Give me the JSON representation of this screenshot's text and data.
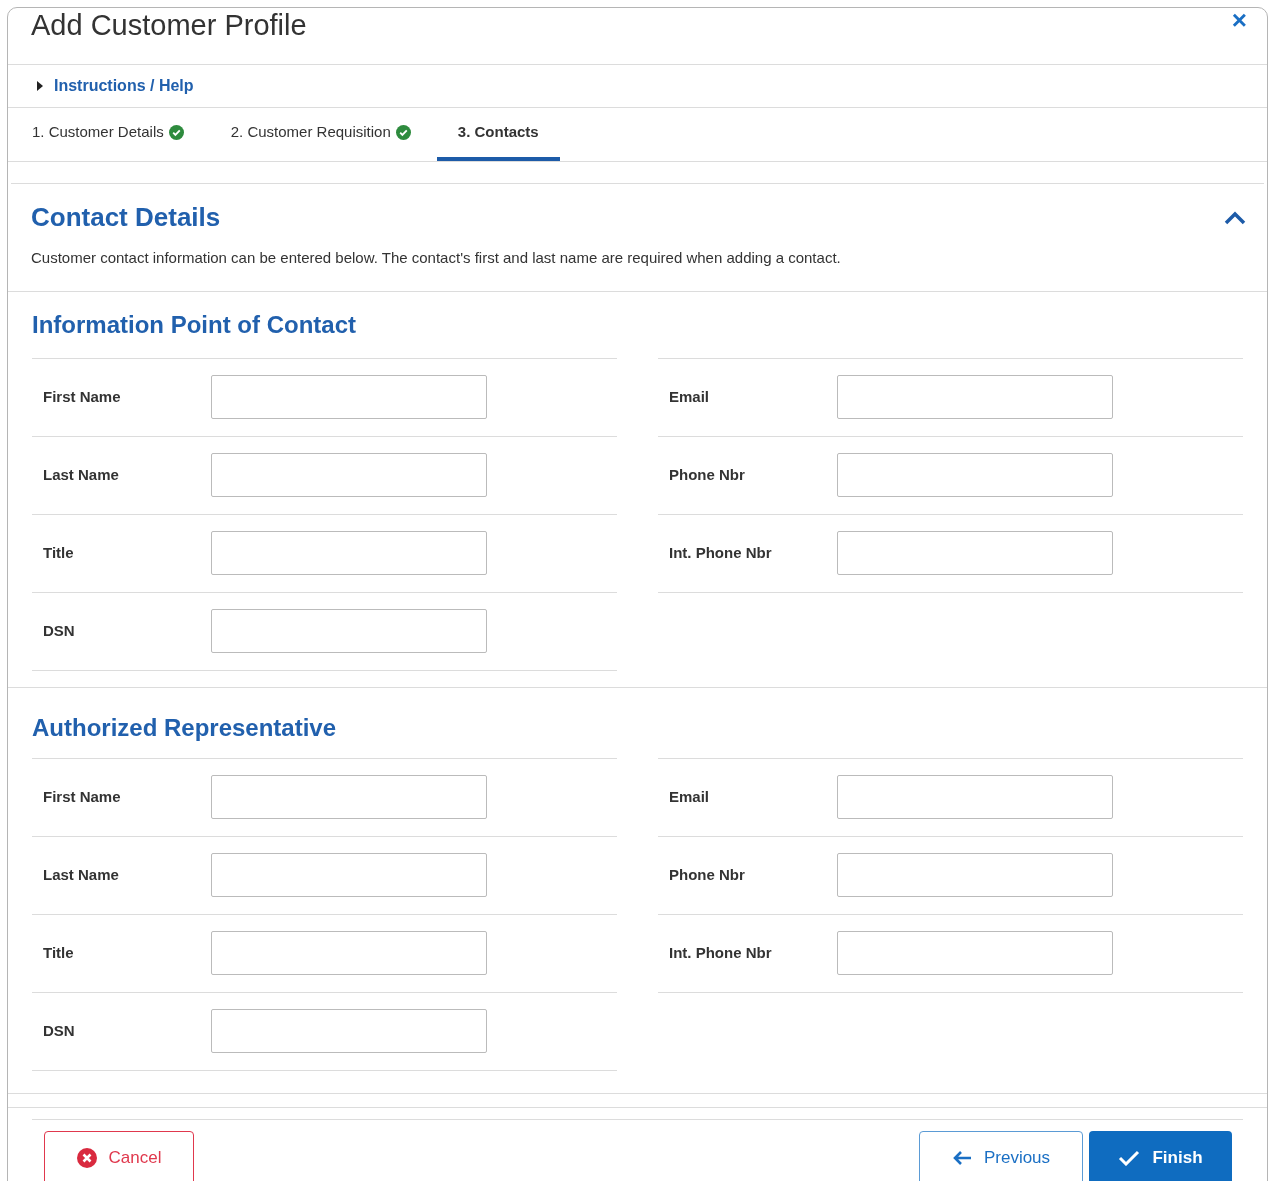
{
  "window": {
    "title": "Add Customer Profile",
    "close": "×"
  },
  "instructions": {
    "label": "Instructions / Help",
    "expanded": false
  },
  "tabs": [
    {
      "label": "1. Customer Details",
      "completed": true,
      "selected": false
    },
    {
      "label": "2. Customer Requisition",
      "completed": true,
      "selected": false
    },
    {
      "label": "3. Contacts",
      "completed": false,
      "selected": true
    }
  ],
  "panel": {
    "title": "Contact Details",
    "expanded": true,
    "description": "Customer contact information can be entered below. The contact's first and last name are required when adding a contact."
  },
  "sections": [
    {
      "title": "Information Point of Contact",
      "left": [
        {
          "label": "First Name"
        },
        {
          "label": "Last Name"
        },
        {
          "label": "Title"
        },
        {
          "label": "DSN"
        }
      ],
      "right": [
        {
          "label": "Email"
        },
        {
          "label": "Phone Nbr"
        },
        {
          "label": "Int. Phone Nbr"
        }
      ]
    },
    {
      "title": "Authorized Representative",
      "left": [
        {
          "label": "First Name"
        },
        {
          "label": "Last Name"
        },
        {
          "label": "Title"
        },
        {
          "label": "DSN"
        }
      ],
      "right": [
        {
          "label": "Email"
        },
        {
          "label": "Phone Nbr"
        },
        {
          "label": "Int. Phone Nbr"
        }
      ]
    }
  ],
  "buttons": {
    "cancel": "Cancel",
    "previous": "Previous",
    "finish": "Finish"
  }
}
